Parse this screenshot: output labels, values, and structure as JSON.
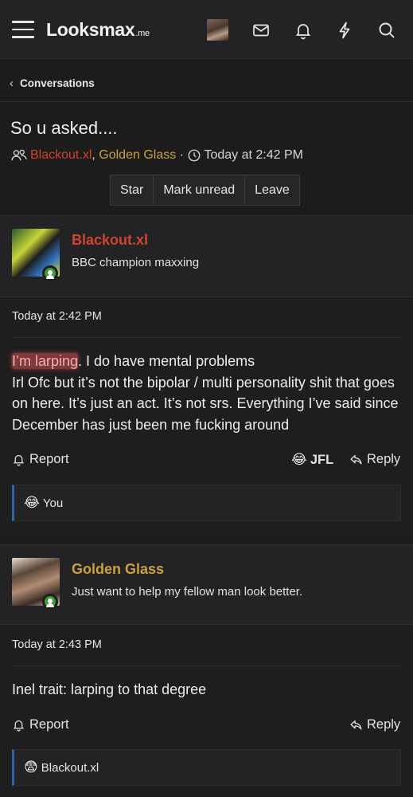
{
  "nav": {
    "logo_main": "Looksmax",
    "logo_tld": ".me",
    "icons": [
      "menu-icon",
      "avatar",
      "mail-icon",
      "bell-icon",
      "bolt-icon",
      "search-icon"
    ]
  },
  "breadcrumb": {
    "label": "Conversations"
  },
  "conversation": {
    "title": "So u asked....",
    "participant_1": "Blackout.xl",
    "separator": ",",
    "participant_2": "Golden Glass",
    "dot": "·",
    "time": "Today at 2:42 PM",
    "buttons": {
      "star": "Star",
      "mark_unread": "Mark unread",
      "leave": "Leave"
    }
  },
  "messages": [
    {
      "author": "Blackout.xl",
      "user_title": "BBC champion maxxing",
      "date": "Today at 2:42 PM",
      "highlight": "I’m larping",
      "line1_rest": ". I do have mental problems",
      "line2": "Irl Ofc but it’s not the bipolar / multi personality shit that goes on here. It’s just an act. It’s not srs. Everything I’ve said since December has just been me fucking around",
      "report_label": "Report",
      "reaction_emoji": "😂",
      "reaction_label": "JFL",
      "reply_label": "Reply",
      "reactions_summary_emoji": "😂",
      "reactions_summary": "You"
    },
    {
      "author": "Golden Glass",
      "user_title": "Just want to help my fellow man look better.",
      "date": "Today at 2:43 PM",
      "text": "Inel trait: larping to that degree",
      "report_label": "Report",
      "reply_label": "Reply",
      "reactions_summary_emoji": "😨",
      "reactions_summary": "Blackout.xl"
    }
  ],
  "colors": {
    "blackout_name": "#d2432c",
    "golden_name": "#c9a23d",
    "online": "#3f9a3a",
    "reaction_bar": "#2d63a7"
  }
}
